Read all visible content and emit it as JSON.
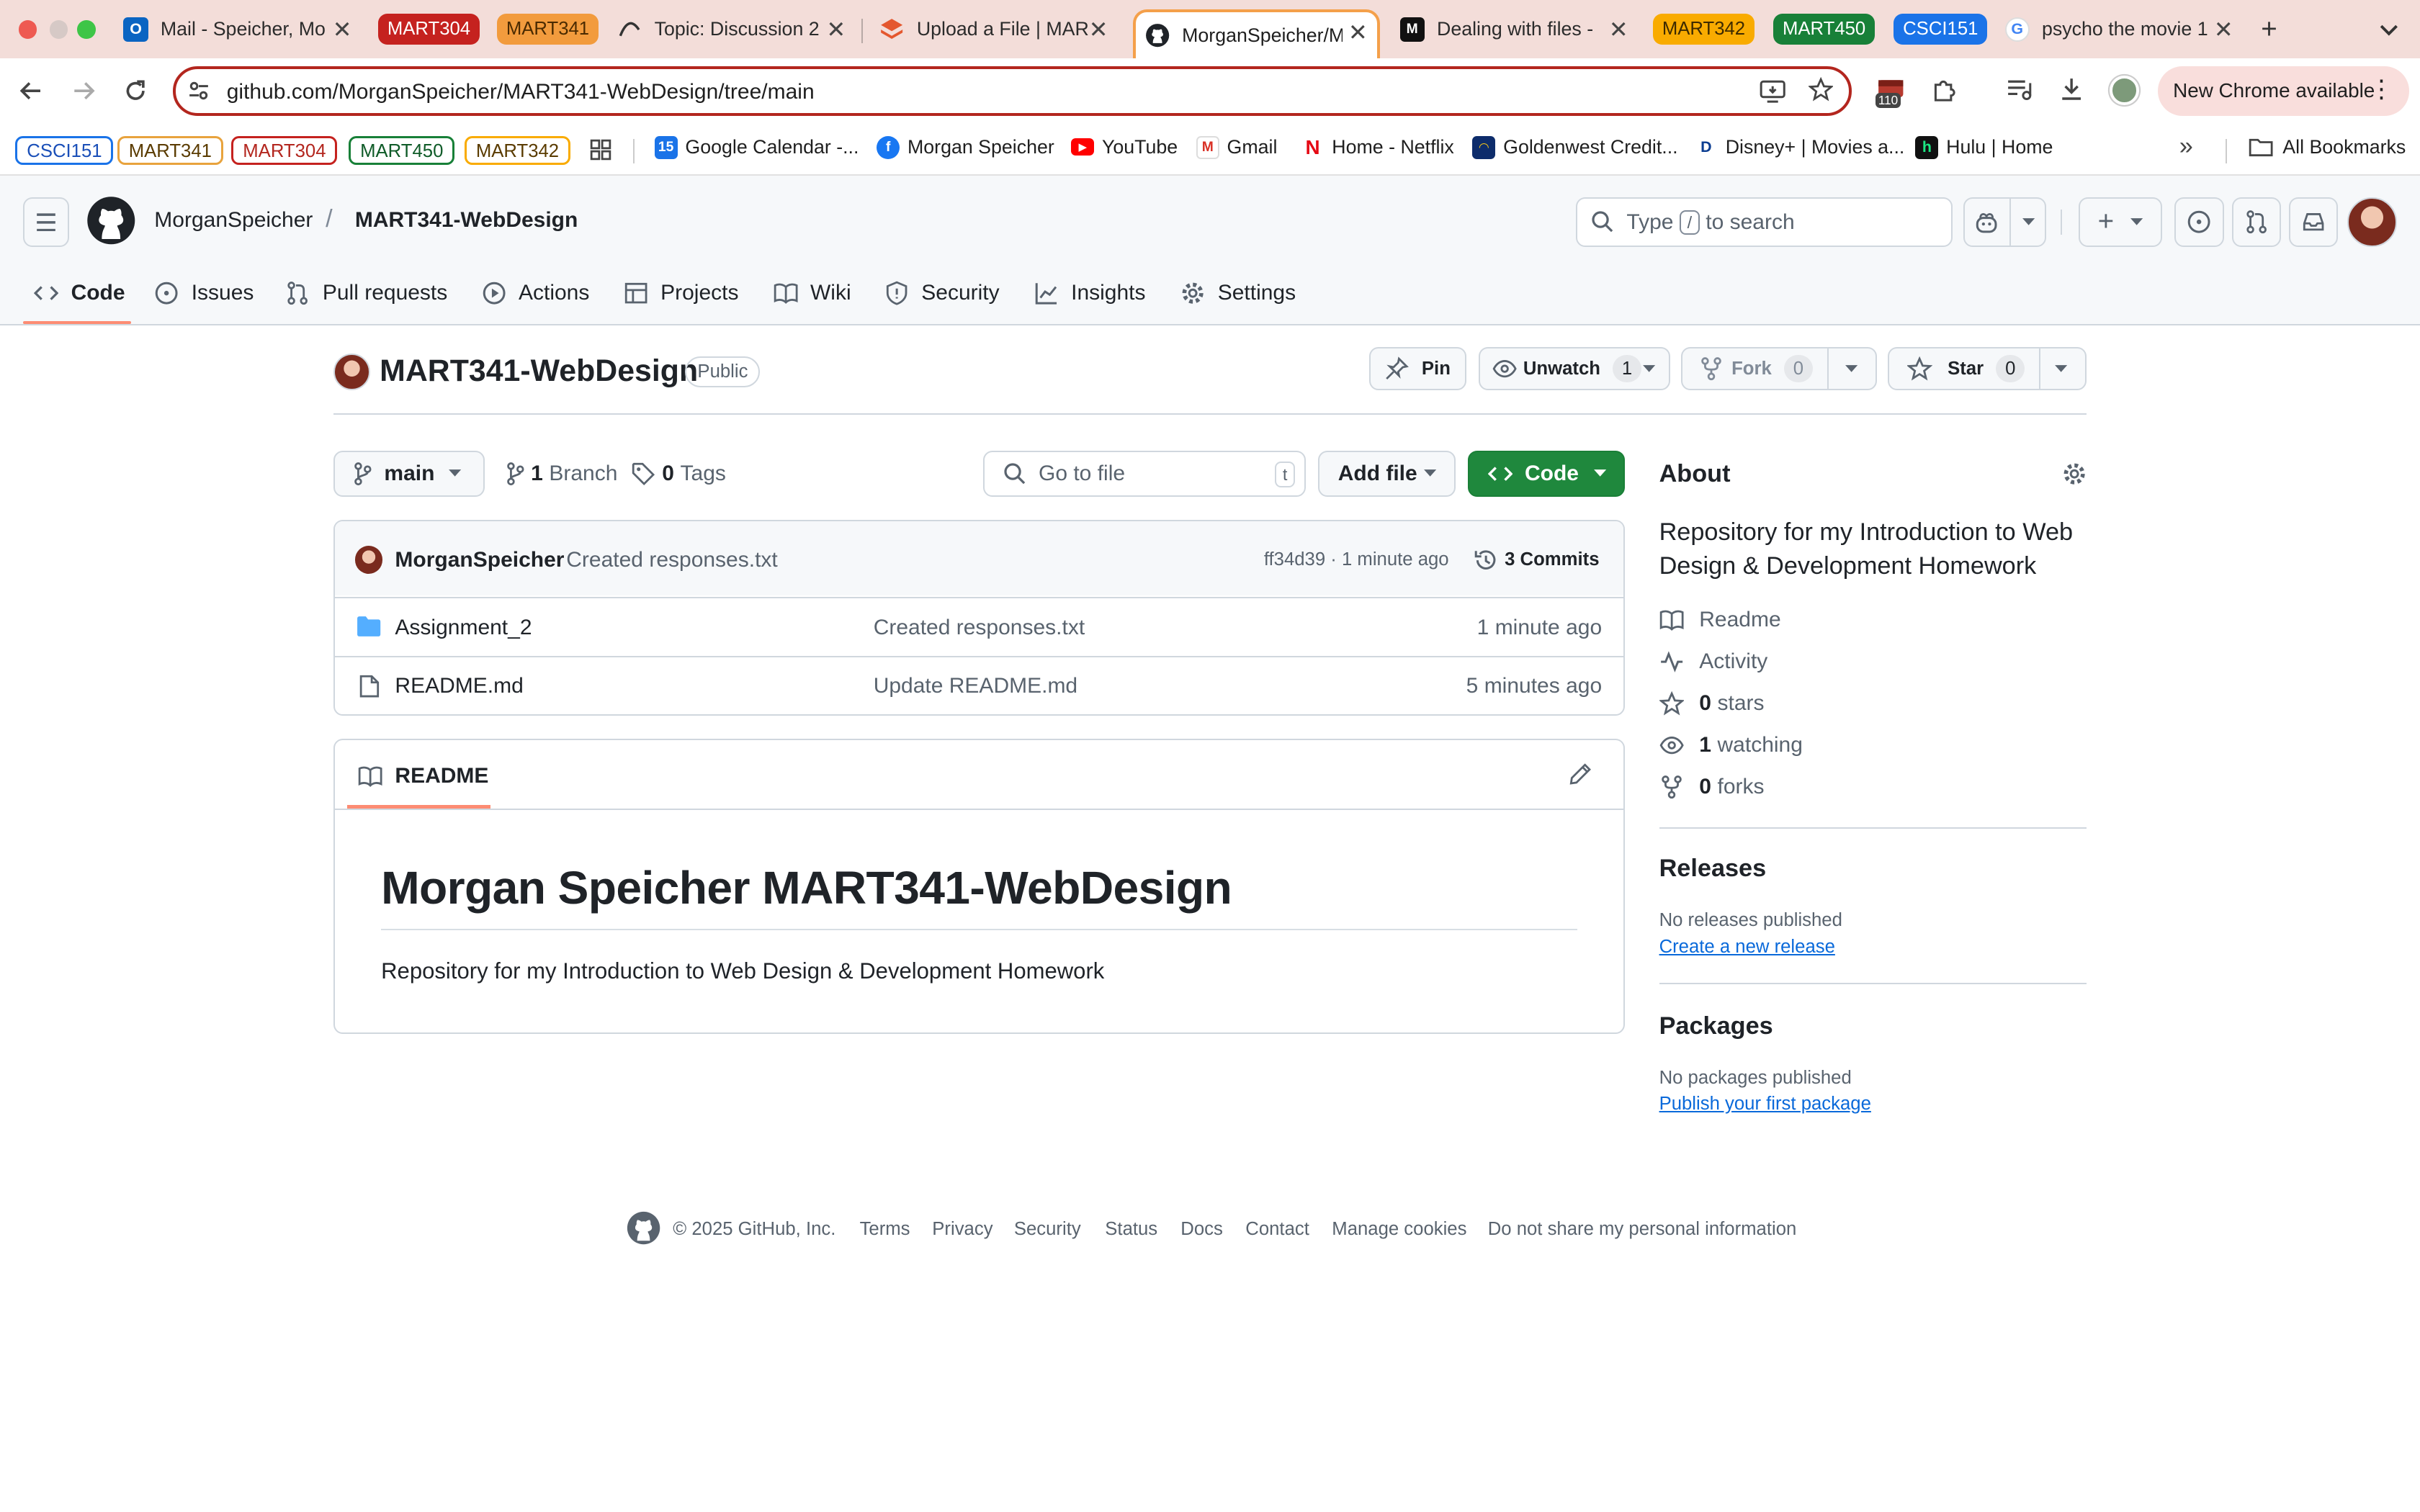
{
  "browser": {
    "tabs": [
      {
        "title": "Mail - Speicher, Mo",
        "favicon": "outlook-icon"
      },
      {
        "title": "Topic: Discussion 2",
        "favicon": "canvas-discussion-icon"
      },
      {
        "title": "Upload a File | MAR",
        "favicon": "canvas-icon"
      },
      {
        "title": "MorganSpeicher/M",
        "favicon": "github-icon",
        "active": true
      },
      {
        "title": "Dealing with files -",
        "favicon": "medium-icon"
      },
      {
        "title": "psycho the movie 1",
        "favicon": "google-icon"
      }
    ],
    "tab_groups": [
      {
        "label": "MART304",
        "color": "#c5221f"
      },
      {
        "label": "MART341",
        "color": "#f29b3d"
      },
      {
        "label": "MART342",
        "color": "#f9ab00"
      },
      {
        "label": "MART450",
        "color": "#188038"
      },
      {
        "label": "CSCI151",
        "color": "#1a73e8"
      }
    ],
    "url": "github.com/MorganSpeicher/MART341-WebDesign/tree/main",
    "extension_badge": "110",
    "new_chrome_label": "New Chrome available",
    "bookmark_groups": [
      {
        "label": "CSCI151",
        "color": "#1a73e8"
      },
      {
        "label": "MART341",
        "color": "#e8a33d"
      },
      {
        "label": "MART304",
        "color": "#c5221f"
      },
      {
        "label": "MART450",
        "color": "#188038"
      },
      {
        "label": "MART342",
        "color": "#f9ab00"
      }
    ],
    "bookmarks": [
      {
        "label": "Google Calendar -...",
        "icon": "google-calendar-icon"
      },
      {
        "label": "Morgan Speicher",
        "icon": "facebook-icon"
      },
      {
        "label": "YouTube",
        "icon": "youtube-icon"
      },
      {
        "label": "Gmail",
        "icon": "gmail-icon"
      },
      {
        "label": "Home - Netflix",
        "icon": "netflix-icon"
      },
      {
        "label": "Goldenwest Credit...",
        "icon": "goldenwest-icon"
      },
      {
        "label": "Disney+ | Movies a...",
        "icon": "disney-icon"
      },
      {
        "label": "Hulu | Home",
        "icon": "hulu-icon"
      }
    ],
    "all_bookmarks_label": "All Bookmarks"
  },
  "github": {
    "owner": "MorganSpeicher",
    "repo": "MART341-WebDesign",
    "search": {
      "prefix": "Type",
      "key": "/",
      "suffix": "to search"
    },
    "nav": [
      "Code",
      "Issues",
      "Pull requests",
      "Actions",
      "Projects",
      "Wiki",
      "Security",
      "Insights",
      "Settings"
    ],
    "repo_header": {
      "visibility": "Public",
      "pin_label": "Pin",
      "unwatch_label": "Unwatch",
      "watch_count": "1",
      "fork_label": "Fork",
      "fork_count": "0",
      "star_label": "Star",
      "star_count": "0"
    },
    "branch": {
      "current": "main",
      "branch_count": "1",
      "branch_word": "Branch",
      "tag_count": "0",
      "tag_word": "Tags",
      "go_to_file": "Go to file",
      "go_key": "t",
      "add_file": "Add file",
      "code_label": "Code"
    },
    "latest_commit": {
      "author": "MorganSpeicher",
      "message": "Created responses.txt",
      "hash_time": "ff34d39 · 1 minute ago",
      "commits": "3 Commits"
    },
    "files": [
      {
        "name": "Assignment_2",
        "type": "folder",
        "message": "Created responses.txt",
        "time": "1 minute ago"
      },
      {
        "name": "README.md",
        "type": "file",
        "message": "Update README.md",
        "time": "5 minutes ago"
      }
    ],
    "readme": {
      "tab_label": "README",
      "heading": "Morgan Speicher MART341-WebDesign",
      "body": "Repository for my Introduction to Web Design & Development Homework"
    },
    "about": {
      "title": "About",
      "description": "Repository for my Introduction to Web Design & Development Homework",
      "readme": "Readme",
      "activity": "Activity",
      "stars_num": "0",
      "stars_word": "stars",
      "watching_num": "1",
      "watching_word": "watching",
      "forks_num": "0",
      "forks_word": "forks"
    },
    "releases": {
      "title": "Releases",
      "none": "No releases published",
      "link": "Create a new release"
    },
    "packages": {
      "title": "Packages",
      "none": "No packages published",
      "link": "Publish your first package"
    },
    "footer": {
      "copyright": "© 2025 GitHub, Inc.",
      "links": [
        "Terms",
        "Privacy",
        "Security",
        "Status",
        "Docs",
        "Contact",
        "Manage cookies",
        "Do not share my personal information"
      ]
    }
  }
}
